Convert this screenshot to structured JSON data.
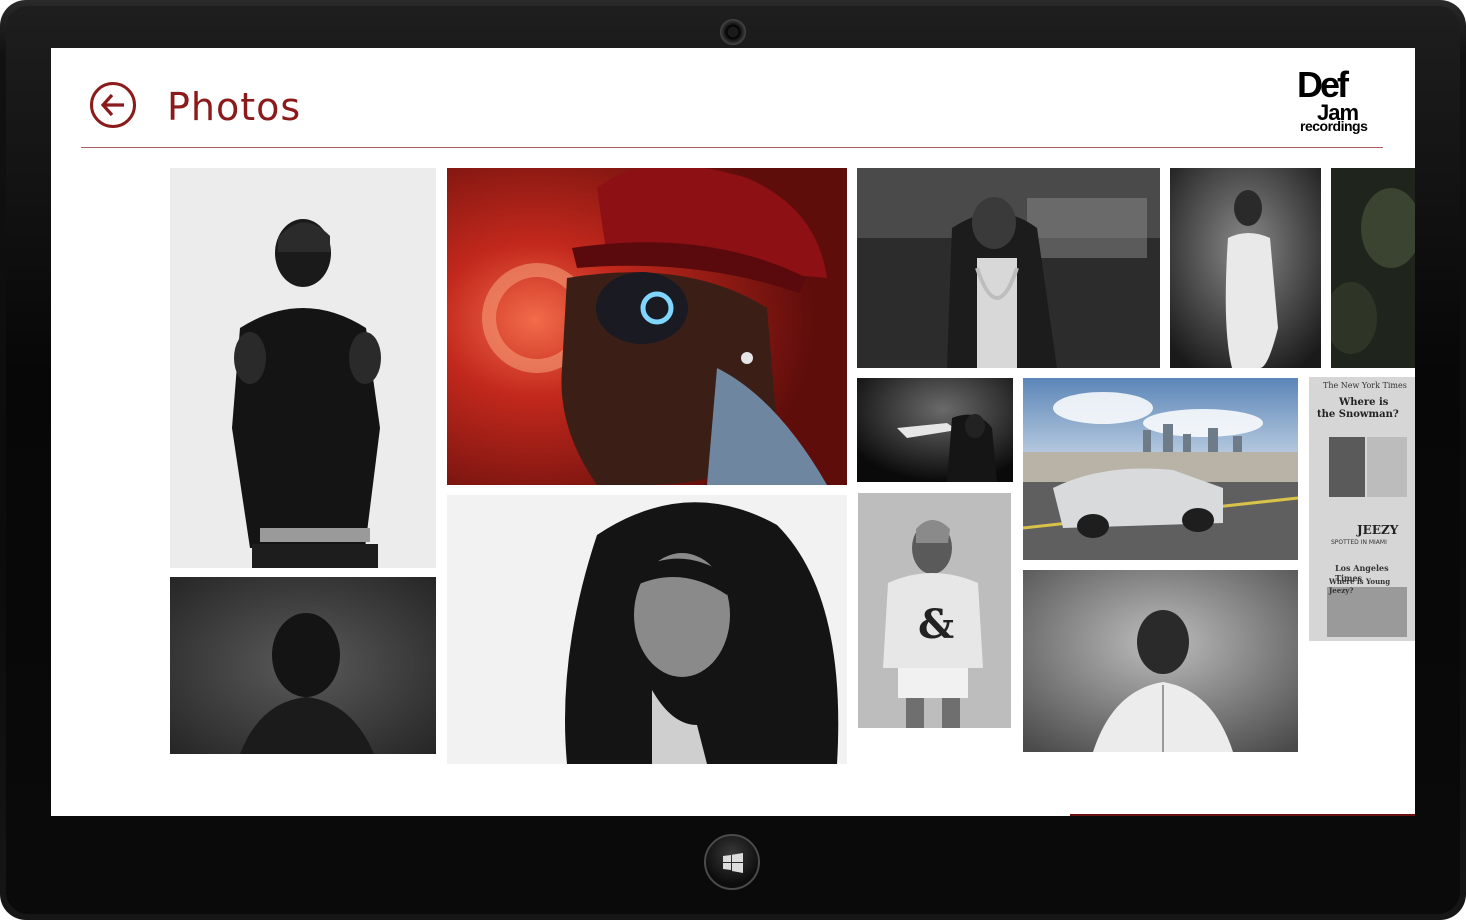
{
  "page": {
    "title": "Photos"
  },
  "header": {
    "back_icon": "arrow-left-icon",
    "logo": {
      "line1": "Def",
      "line2": "Jam",
      "line3": "recordings"
    }
  },
  "colors": {
    "accent": "#8b1a1a",
    "bezel": "#0d0d0d",
    "background": "#ffffff"
  },
  "gallery": {
    "tiles": [
      {
        "subject": "man-hands-raised-bw"
      },
      {
        "subject": "man-back-of-head-bw"
      },
      {
        "subject": "man-red-cap-sunglasses-color"
      },
      {
        "subject": "woman-long-hair-bw"
      },
      {
        "subject": "man-gold-chains-bw"
      },
      {
        "subject": "concert-performer-bw"
      },
      {
        "subject": "woman-ampersand-shirt-bw"
      },
      {
        "subject": "woman-white-dress-bw"
      },
      {
        "subject": "silver-convertible-skyline-color"
      },
      {
        "subject": "man-white-shirt-bw"
      },
      {
        "subject": "dark-foliage"
      },
      {
        "subject": "newspaper-collage-bw"
      }
    ],
    "newspaper": {
      "masthead": "The New York Times",
      "headline1": "Where is",
      "headline2": "the Snowman?",
      "name": "JEEZY",
      "subhead": "SPOTTED IN MIAMI",
      "masthead2": "Los Angeles Times",
      "headline3": "Where is Young Jeezy?"
    }
  }
}
